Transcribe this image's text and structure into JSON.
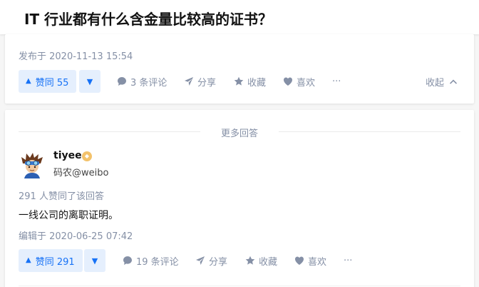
{
  "question": {
    "title": "IT 行业都有什么含金量比较高的证书？"
  },
  "answer1": {
    "published": "发布于 2020-11-13 15:54",
    "vote_up_label": "赞同 55",
    "comments_label": "3 条评论",
    "share_label": "分享",
    "collect_label": "收藏",
    "like_label": "喜欢",
    "more_label": "···",
    "collapse_label": "收起"
  },
  "more_answers": {
    "label": "更多回答"
  },
  "answer2": {
    "author": {
      "name": "tiyee",
      "bio": "码农@weibo"
    },
    "votes_text": "291 人赞同了该回答",
    "content": "一线公司的离职证明。",
    "edited": "编辑于 2020-06-25 07:42",
    "vote_up_label": "赞同 291",
    "comments_label": "19 条评论",
    "share_label": "分享",
    "collect_label": "收藏",
    "like_label": "喜欢",
    "more_label": "···"
  },
  "colors": {
    "accent": "#1772f6",
    "accent_bg": "#e5effd",
    "muted": "#8590a6",
    "page_bg": "#f6f6f6"
  },
  "icons": [
    "comment-icon",
    "share-icon",
    "star-icon",
    "heart-icon",
    "more-icon",
    "chevron-up-icon",
    "badge-icon"
  ]
}
